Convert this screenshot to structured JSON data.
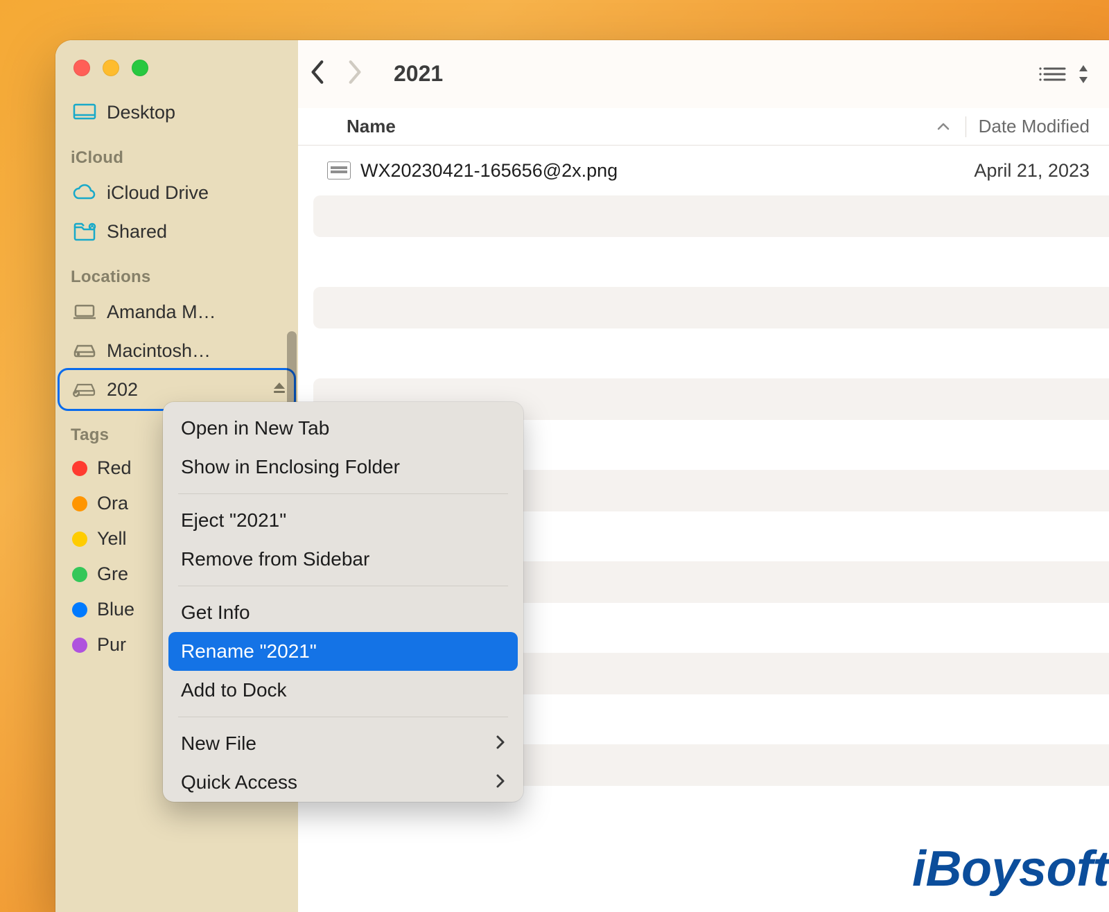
{
  "toolbar": {
    "title": "2021"
  },
  "columns": {
    "name": "Name",
    "date": "Date Modified"
  },
  "sidebar": {
    "favorites": {
      "desktop": "Desktop"
    },
    "icloud_label": "iCloud",
    "icloud": {
      "drive": "iCloud Drive",
      "shared": "Shared"
    },
    "locations_label": "Locations",
    "locations": {
      "amanda": "Amanda M…",
      "macintosh": "Macintosh…",
      "volume": "202"
    },
    "tags_label": "Tags",
    "tags": {
      "red": "Red",
      "orange": "Ora",
      "yellow": "Yell",
      "green": "Gre",
      "blue": "Blue",
      "purple": "Pur"
    }
  },
  "tag_colors": {
    "red": "#ff3b30",
    "orange": "#ff9500",
    "yellow": "#ffcc00",
    "green": "#34c759",
    "blue": "#007aff",
    "purple": "#af52de"
  },
  "files": [
    {
      "name": "WX20230421-165656@2x.png",
      "date": "April 21, 2023"
    }
  ],
  "context_menu": {
    "open_new_tab": "Open in New Tab",
    "show_enclosing": "Show in Enclosing Folder",
    "eject": "Eject \"2021\"",
    "remove_sidebar": "Remove from Sidebar",
    "get_info": "Get Info",
    "rename": "Rename \"2021\"",
    "add_to_dock": "Add to Dock",
    "new_file": "New File",
    "quick_access": "Quick Access"
  },
  "watermark": "iBoysoft"
}
